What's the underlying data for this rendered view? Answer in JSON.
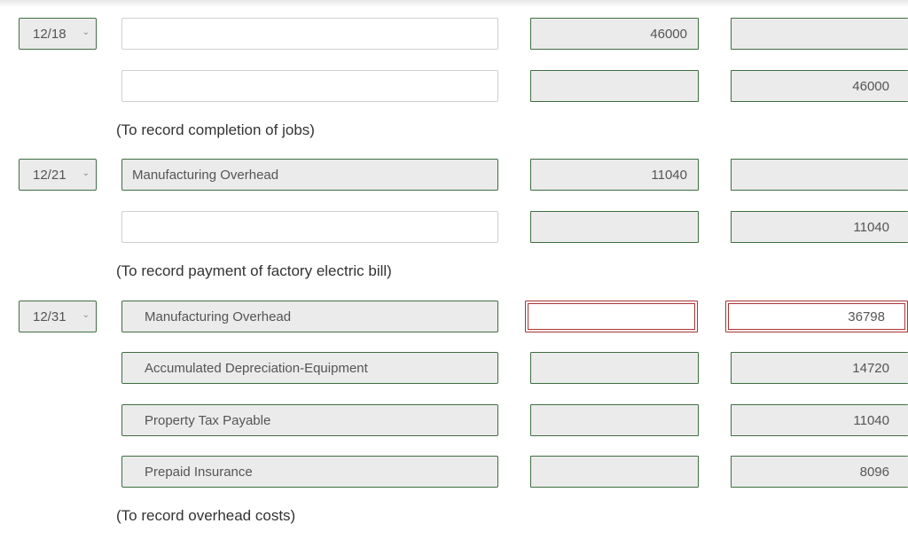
{
  "entries": [
    {
      "date": "12/18",
      "lines": [
        {
          "account": "",
          "debit": "46000",
          "credit": ""
        },
        {
          "account": "",
          "debit": "",
          "credit": "46000"
        }
      ],
      "memo": "(To record completion of jobs)"
    },
    {
      "date": "12/21",
      "lines": [
        {
          "account": "Manufacturing Overhead",
          "debit": "11040",
          "credit": ""
        },
        {
          "account": "",
          "debit": "",
          "credit": "11040"
        }
      ],
      "memo": "(To record payment of factory electric bill)"
    },
    {
      "date": "12/31",
      "lines": [
        {
          "account": "Manufacturing Overhead",
          "debit": "",
          "credit": "36798"
        },
        {
          "account": "Accumulated Depreciation-Equipment",
          "debit": "",
          "credit": "14720"
        },
        {
          "account": "Property Tax Payable",
          "debit": "",
          "credit": "11040"
        },
        {
          "account": "Prepaid Insurance",
          "debit": "",
          "credit": "8096"
        }
      ],
      "memo": "(To record overhead costs)"
    }
  ],
  "colors": {
    "valid_border": "#3f6e42",
    "error_border": "#aa3333"
  }
}
